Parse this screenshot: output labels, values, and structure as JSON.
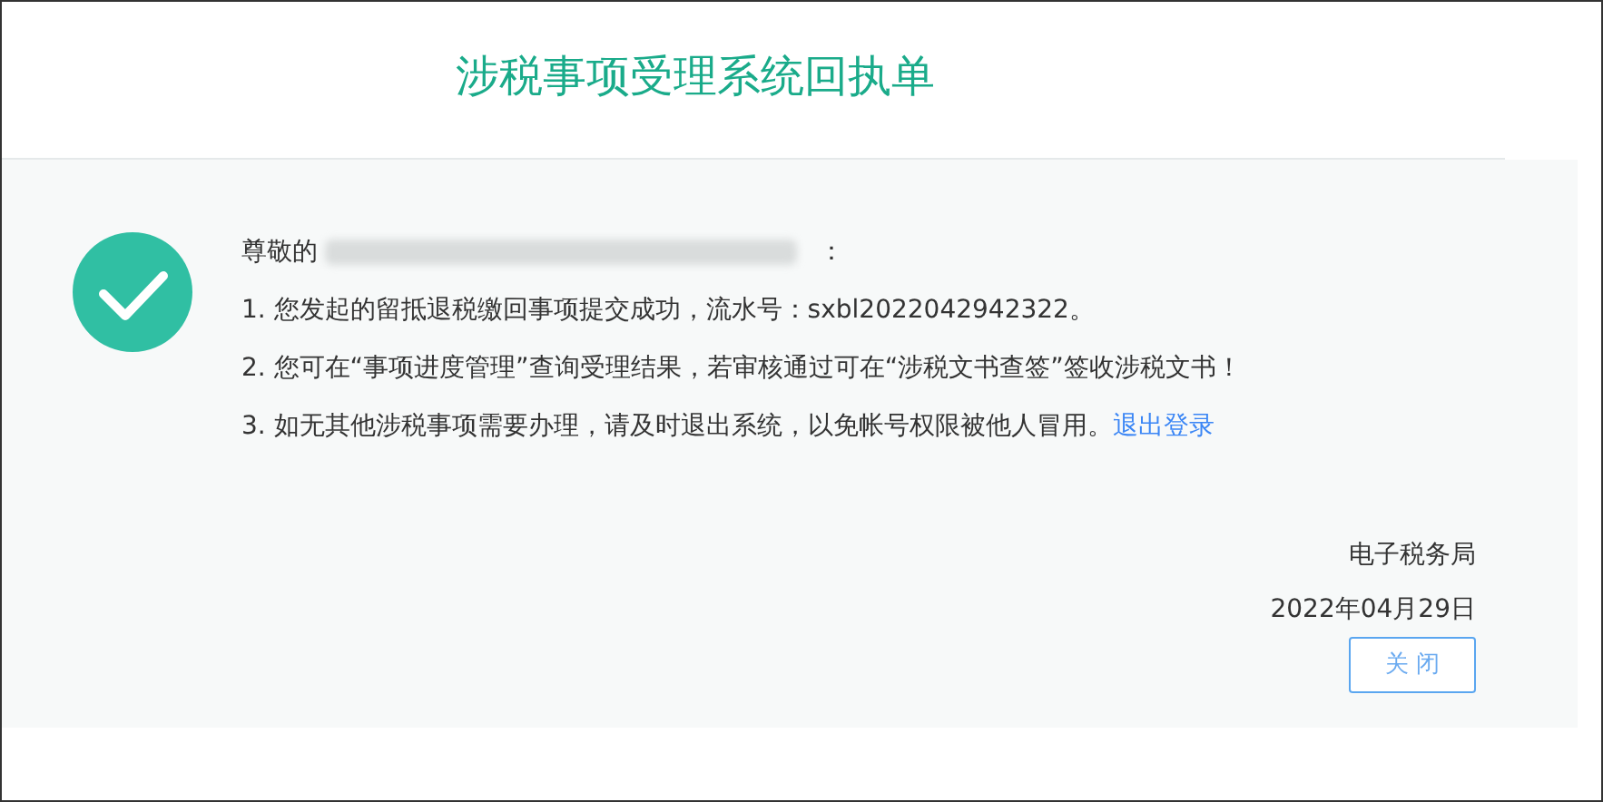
{
  "title": "涉税事项受理系统回执单",
  "greeting": {
    "before": "尊敬的",
    "after": "："
  },
  "lines": [
    {
      "text": "1. 您发起的留抵退税缴回事项提交成功，流水号：sxbl2022042942322。"
    },
    {
      "text": "2. 您可在“事项进度管理”查询受理结果，若审核通过可在“涉税文书查签”签收涉税文书！"
    },
    {
      "text": "3. 如无其他涉税事项需要办理，请及时退出系统，以免帐号权限被他人冒用。",
      "link": "退出登录"
    }
  ],
  "signature": "电子税务局",
  "date": "2022年04月29日",
  "buttons": [
    "关 闭"
  ]
}
